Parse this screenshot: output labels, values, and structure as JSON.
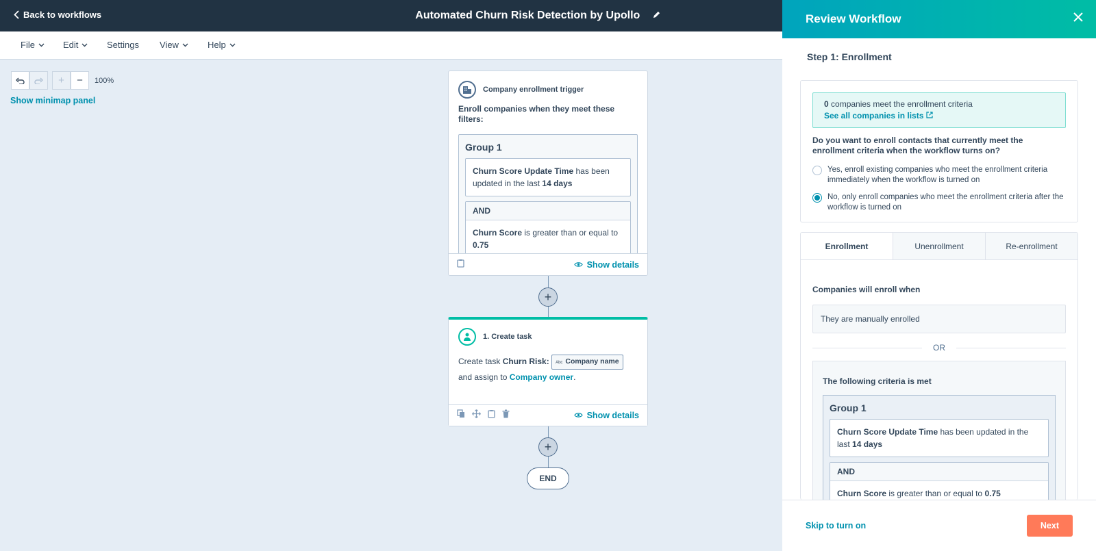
{
  "header": {
    "back_label": "Back to workflows",
    "title": "Automated Churn Risk Detection by Upollo"
  },
  "menu": {
    "items": [
      {
        "label": "File",
        "has_caret": true
      },
      {
        "label": "Edit",
        "has_caret": true
      },
      {
        "label": "Settings",
        "has_caret": false
      },
      {
        "label": "View",
        "has_caret": true
      },
      {
        "label": "Help",
        "has_caret": true
      }
    ]
  },
  "canvas": {
    "zoom": "100%",
    "minimap_label": "Show minimap panel",
    "end_label": "END"
  },
  "trigger_card": {
    "title": "Company enrollment trigger",
    "description": "Enroll companies when they meet these filters:",
    "group_title": "Group 1",
    "filter1_prop": "Churn Score Update Time",
    "filter1_text_a": " has been updated in the last ",
    "filter1_value": "14 days",
    "and_label": "AND",
    "filter2_prop": "Churn Score",
    "filter2_text": " is greater than or equal to ",
    "filter2_value": "0.75",
    "show_details": "Show details"
  },
  "task_card": {
    "title": "1. Create task",
    "text_a": "Create task ",
    "task_name": "Churn Risk:",
    "token_type": "Abc",
    "token_label": "Company name",
    "text_b": "and assign to ",
    "owner": "Company owner",
    "text_c": ".",
    "show_details": "Show details"
  },
  "panel": {
    "title": "Review Workflow",
    "step": "Step 1: Enrollment",
    "count": "0",
    "count_text": " companies meet the enrollment criteria",
    "see_all": "See all companies in lists",
    "question": "Do you want to enroll contacts that currently meet the enrollment criteria when the workflow turns on?",
    "option_yes": "Yes, enroll existing companies who meet the enrollment criteria immediately when the workflow is turned on",
    "option_no": "No, only enroll companies who meet the enrollment criteria after the workflow is turned on",
    "tabs": [
      "Enrollment",
      "Unenrollment",
      "Re-enrollment"
    ],
    "enroll_when_label": "Companies will enroll when",
    "manual": "They are manually enrolled",
    "or": "OR",
    "criteria_title": "The following criteria is met",
    "group_title": "Group 1",
    "filter1_prop": "Churn Score Update Time",
    "filter1_text_a": " has been updated in the last ",
    "filter1_value": "14 days",
    "and_label": "AND",
    "filter2_prop": "Churn Score",
    "filter2_text": " is greater than or equal to ",
    "filter2_value": "0.75",
    "skip": "Skip to turn on",
    "next": "Next"
  },
  "colors": {
    "topbar": "#213343",
    "accent_teal": "#00a4bd",
    "link": "#0091ae",
    "next_button": "#ff7a59",
    "canvas_bg": "#e5edf5"
  }
}
